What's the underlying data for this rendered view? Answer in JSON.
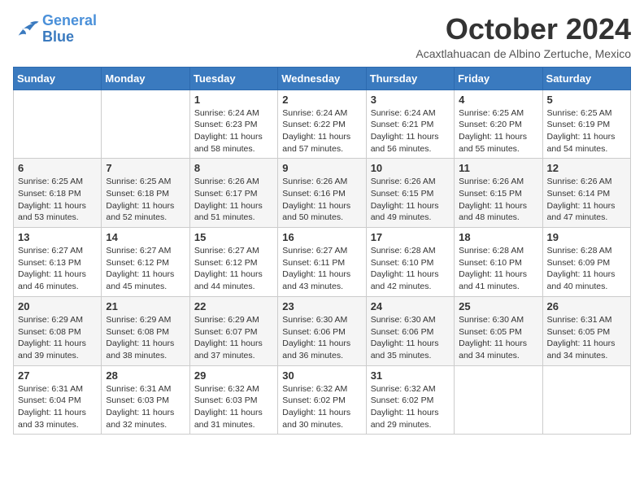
{
  "logo": {
    "line1": "General",
    "line2": "Blue"
  },
  "title": "October 2024",
  "location": "Acaxtlahuacan de Albino Zertuche, Mexico",
  "weekdays": [
    "Sunday",
    "Monday",
    "Tuesday",
    "Wednesday",
    "Thursday",
    "Friday",
    "Saturday"
  ],
  "weeks": [
    [
      {
        "day": "",
        "sunrise": "",
        "sunset": "",
        "daylight": ""
      },
      {
        "day": "",
        "sunrise": "",
        "sunset": "",
        "daylight": ""
      },
      {
        "day": "1",
        "sunrise": "Sunrise: 6:24 AM",
        "sunset": "Sunset: 6:23 PM",
        "daylight": "Daylight: 11 hours and 58 minutes."
      },
      {
        "day": "2",
        "sunrise": "Sunrise: 6:24 AM",
        "sunset": "Sunset: 6:22 PM",
        "daylight": "Daylight: 11 hours and 57 minutes."
      },
      {
        "day": "3",
        "sunrise": "Sunrise: 6:24 AM",
        "sunset": "Sunset: 6:21 PM",
        "daylight": "Daylight: 11 hours and 56 minutes."
      },
      {
        "day": "4",
        "sunrise": "Sunrise: 6:25 AM",
        "sunset": "Sunset: 6:20 PM",
        "daylight": "Daylight: 11 hours and 55 minutes."
      },
      {
        "day": "5",
        "sunrise": "Sunrise: 6:25 AM",
        "sunset": "Sunset: 6:19 PM",
        "daylight": "Daylight: 11 hours and 54 minutes."
      }
    ],
    [
      {
        "day": "6",
        "sunrise": "Sunrise: 6:25 AM",
        "sunset": "Sunset: 6:18 PM",
        "daylight": "Daylight: 11 hours and 53 minutes."
      },
      {
        "day": "7",
        "sunrise": "Sunrise: 6:25 AM",
        "sunset": "Sunset: 6:18 PM",
        "daylight": "Daylight: 11 hours and 52 minutes."
      },
      {
        "day": "8",
        "sunrise": "Sunrise: 6:26 AM",
        "sunset": "Sunset: 6:17 PM",
        "daylight": "Daylight: 11 hours and 51 minutes."
      },
      {
        "day": "9",
        "sunrise": "Sunrise: 6:26 AM",
        "sunset": "Sunset: 6:16 PM",
        "daylight": "Daylight: 11 hours and 50 minutes."
      },
      {
        "day": "10",
        "sunrise": "Sunrise: 6:26 AM",
        "sunset": "Sunset: 6:15 PM",
        "daylight": "Daylight: 11 hours and 49 minutes."
      },
      {
        "day": "11",
        "sunrise": "Sunrise: 6:26 AM",
        "sunset": "Sunset: 6:15 PM",
        "daylight": "Daylight: 11 hours and 48 minutes."
      },
      {
        "day": "12",
        "sunrise": "Sunrise: 6:26 AM",
        "sunset": "Sunset: 6:14 PM",
        "daylight": "Daylight: 11 hours and 47 minutes."
      }
    ],
    [
      {
        "day": "13",
        "sunrise": "Sunrise: 6:27 AM",
        "sunset": "Sunset: 6:13 PM",
        "daylight": "Daylight: 11 hours and 46 minutes."
      },
      {
        "day": "14",
        "sunrise": "Sunrise: 6:27 AM",
        "sunset": "Sunset: 6:12 PM",
        "daylight": "Daylight: 11 hours and 45 minutes."
      },
      {
        "day": "15",
        "sunrise": "Sunrise: 6:27 AM",
        "sunset": "Sunset: 6:12 PM",
        "daylight": "Daylight: 11 hours and 44 minutes."
      },
      {
        "day": "16",
        "sunrise": "Sunrise: 6:27 AM",
        "sunset": "Sunset: 6:11 PM",
        "daylight": "Daylight: 11 hours and 43 minutes."
      },
      {
        "day": "17",
        "sunrise": "Sunrise: 6:28 AM",
        "sunset": "Sunset: 6:10 PM",
        "daylight": "Daylight: 11 hours and 42 minutes."
      },
      {
        "day": "18",
        "sunrise": "Sunrise: 6:28 AM",
        "sunset": "Sunset: 6:10 PM",
        "daylight": "Daylight: 11 hours and 41 minutes."
      },
      {
        "day": "19",
        "sunrise": "Sunrise: 6:28 AM",
        "sunset": "Sunset: 6:09 PM",
        "daylight": "Daylight: 11 hours and 40 minutes."
      }
    ],
    [
      {
        "day": "20",
        "sunrise": "Sunrise: 6:29 AM",
        "sunset": "Sunset: 6:08 PM",
        "daylight": "Daylight: 11 hours and 39 minutes."
      },
      {
        "day": "21",
        "sunrise": "Sunrise: 6:29 AM",
        "sunset": "Sunset: 6:08 PM",
        "daylight": "Daylight: 11 hours and 38 minutes."
      },
      {
        "day": "22",
        "sunrise": "Sunrise: 6:29 AM",
        "sunset": "Sunset: 6:07 PM",
        "daylight": "Daylight: 11 hours and 37 minutes."
      },
      {
        "day": "23",
        "sunrise": "Sunrise: 6:30 AM",
        "sunset": "Sunset: 6:06 PM",
        "daylight": "Daylight: 11 hours and 36 minutes."
      },
      {
        "day": "24",
        "sunrise": "Sunrise: 6:30 AM",
        "sunset": "Sunset: 6:06 PM",
        "daylight": "Daylight: 11 hours and 35 minutes."
      },
      {
        "day": "25",
        "sunrise": "Sunrise: 6:30 AM",
        "sunset": "Sunset: 6:05 PM",
        "daylight": "Daylight: 11 hours and 34 minutes."
      },
      {
        "day": "26",
        "sunrise": "Sunrise: 6:31 AM",
        "sunset": "Sunset: 6:05 PM",
        "daylight": "Daylight: 11 hours and 34 minutes."
      }
    ],
    [
      {
        "day": "27",
        "sunrise": "Sunrise: 6:31 AM",
        "sunset": "Sunset: 6:04 PM",
        "daylight": "Daylight: 11 hours and 33 minutes."
      },
      {
        "day": "28",
        "sunrise": "Sunrise: 6:31 AM",
        "sunset": "Sunset: 6:03 PM",
        "daylight": "Daylight: 11 hours and 32 minutes."
      },
      {
        "day": "29",
        "sunrise": "Sunrise: 6:32 AM",
        "sunset": "Sunset: 6:03 PM",
        "daylight": "Daylight: 11 hours and 31 minutes."
      },
      {
        "day": "30",
        "sunrise": "Sunrise: 6:32 AM",
        "sunset": "Sunset: 6:02 PM",
        "daylight": "Daylight: 11 hours and 30 minutes."
      },
      {
        "day": "31",
        "sunrise": "Sunrise: 6:32 AM",
        "sunset": "Sunset: 6:02 PM",
        "daylight": "Daylight: 11 hours and 29 minutes."
      },
      {
        "day": "",
        "sunrise": "",
        "sunset": "",
        "daylight": ""
      },
      {
        "day": "",
        "sunrise": "",
        "sunset": "",
        "daylight": ""
      }
    ]
  ]
}
